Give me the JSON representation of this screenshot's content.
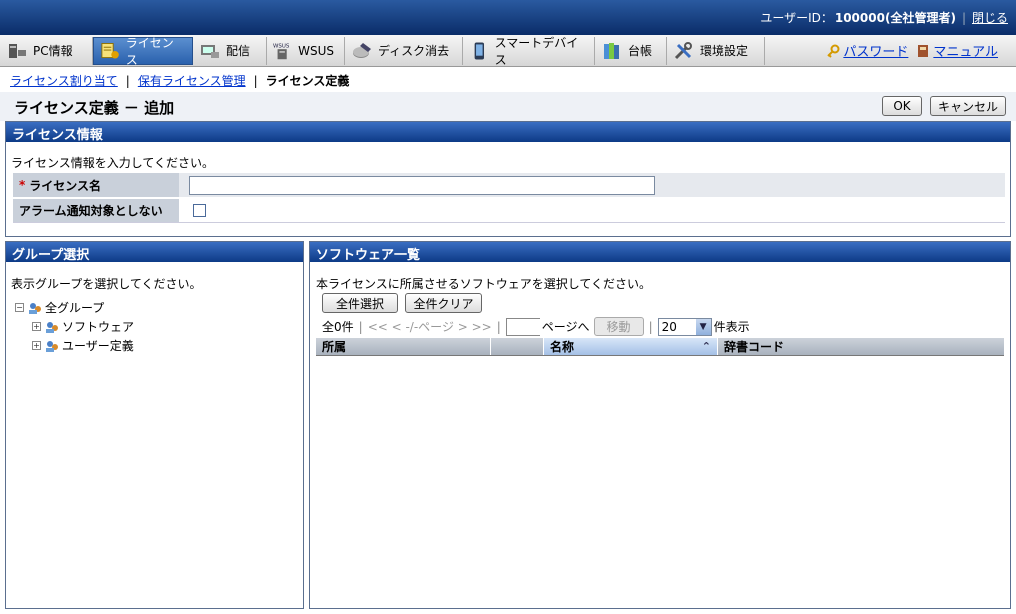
{
  "header": {
    "user_label": "ユーザーID：",
    "user_id": "100000(全社管理者)",
    "close_link": "閉じる"
  },
  "nav": {
    "tabs": [
      {
        "label": "PC情報",
        "icon": "pc-info-icon"
      },
      {
        "label": "ライセンス",
        "icon": "license-icon",
        "active": true
      },
      {
        "label": "配信",
        "icon": "distribution-icon"
      },
      {
        "label": "WSUS",
        "icon": "wsus-icon"
      },
      {
        "label": "ディスク消去",
        "icon": "disk-erase-icon"
      },
      {
        "label": "スマートデバイス",
        "icon": "smart-device-icon"
      },
      {
        "label": "台帳",
        "icon": "ledger-icon"
      },
      {
        "label": "環境設定",
        "icon": "settings-icon"
      }
    ],
    "password_link": "パスワード",
    "manual_link": "マニュアル"
  },
  "breadcrumb": {
    "item1": "ライセンス割り当て",
    "item2": "保有ライセンス管理",
    "current": "ライセンス定義"
  },
  "page": {
    "title": "ライセンス定義 － 追加",
    "ok_button": "OK",
    "cancel_button": "キャンセル"
  },
  "license_info": {
    "header": "ライセンス情報",
    "instruction": "ライセンス情報を入力してください。",
    "required_mark": "*",
    "name_label": "ライセンス名",
    "name_value": "",
    "alarm_label": "アラーム通知対象としない",
    "alarm_checked": false
  },
  "group_select": {
    "header": "グループ選択",
    "instruction": "表示グループを選択してください。",
    "tree": [
      {
        "label": "全グループ",
        "toggle": "⊟"
      },
      {
        "label": "ソフトウェア",
        "toggle": "⊞"
      },
      {
        "label": "ユーザー定義",
        "toggle": "⊞"
      }
    ]
  },
  "software_list": {
    "header": "ソフトウェア一覧",
    "instruction": "本ライセンスに所属させるソフトウェアを選択してください。",
    "select_all_button": "全件選択",
    "clear_all_button": "全件クリア",
    "pager": {
      "count": "全0件",
      "nav": "<< < -/-ページ > >>",
      "page_suffix": "ページへ",
      "move_button": "移動",
      "per_page": "20",
      "per_page_suffix": "件表示"
    },
    "columns": [
      "所属",
      "",
      "名称",
      "辞書コード"
    ],
    "sort_indicator": "⌃",
    "rows": []
  },
  "colors": {
    "header_blue": "#0d3a86",
    "active_tab": "#2a61ad",
    "required": "#cc0000",
    "label_bg": "#c9d0da"
  }
}
